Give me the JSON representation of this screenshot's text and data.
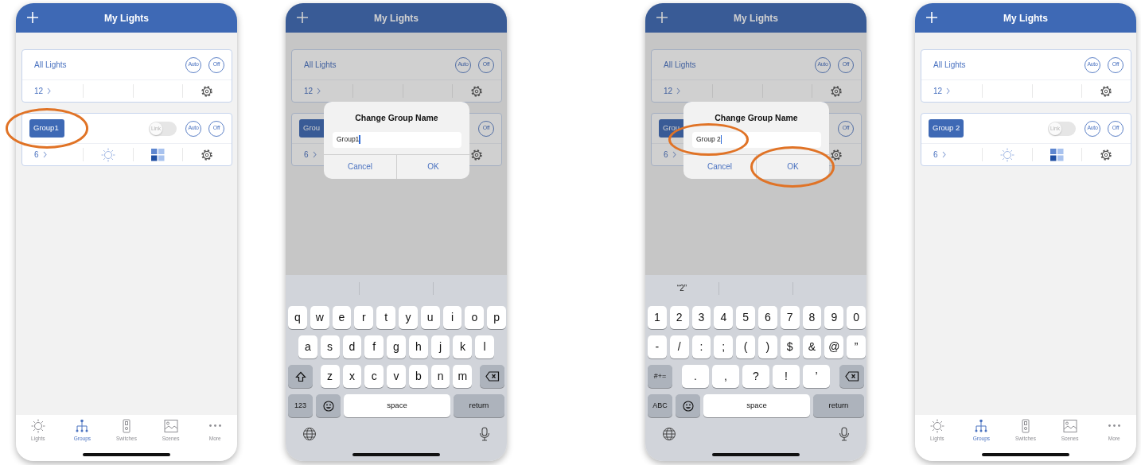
{
  "phones": [
    {
      "header": {
        "title": "My Lights"
      },
      "dimmed": false,
      "cards": [
        {
          "kind": "all",
          "name": "All Lights",
          "buttons": [
            "Auto",
            "Off"
          ],
          "count": "12"
        },
        {
          "kind": "group",
          "name": "Group1",
          "highlighted": true,
          "link": {
            "label": "Link",
            "on": false
          },
          "buttons": [
            "Auto",
            "Off"
          ],
          "count": "6",
          "mode_icons": true
        }
      ],
      "tab_bar": [
        {
          "label": "Lights",
          "selected": false
        },
        {
          "label": "Groups",
          "selected": true
        },
        {
          "label": "Switches",
          "selected": false
        },
        {
          "label": "Scenes",
          "selected": false
        },
        {
          "label": "More",
          "selected": false
        }
      ]
    },
    {
      "header": {
        "title": "My Lights"
      },
      "dimmed": true,
      "cards": [
        {
          "kind": "all",
          "name": "All Lights",
          "buttons": [
            "Auto",
            "Off"
          ],
          "count": "12"
        },
        {
          "kind": "group",
          "name": "Grou",
          "highlighted": false,
          "buttons": [
            "Off"
          ],
          "count": "6"
        }
      ],
      "dialog": {
        "title": "Change Group Name",
        "field": {
          "value": "Group1",
          "highlighted": false
        },
        "buttons": [
          {
            "label": "Cancel",
            "highlighted": false
          },
          {
            "label": "OK",
            "highlighted": false
          }
        ]
      },
      "keyboard": {
        "rows": [
          {
            "keys": [
              {
                "kind": "char",
                "label": "q"
              },
              {
                "kind": "char",
                "label": "w"
              },
              {
                "kind": "char",
                "label": "e"
              },
              {
                "kind": "char",
                "label": "r"
              },
              {
                "kind": "char",
                "label": "t"
              },
              {
                "kind": "char",
                "label": "y"
              },
              {
                "kind": "char",
                "label": "u"
              },
              {
                "kind": "char",
                "label": "i"
              },
              {
                "kind": "char",
                "label": "o"
              },
              {
                "kind": "char",
                "label": "p"
              }
            ]
          },
          {
            "keys": [
              {
                "kind": "char",
                "label": "a"
              },
              {
                "kind": "char",
                "label": "s"
              },
              {
                "kind": "char",
                "label": "d"
              },
              {
                "kind": "char",
                "label": "f"
              },
              {
                "kind": "char",
                "label": "g"
              },
              {
                "kind": "char",
                "label": "h"
              },
              {
                "kind": "char",
                "label": "j"
              },
              {
                "kind": "char",
                "label": "k"
              },
              {
                "kind": "char",
                "label": "l"
              }
            ]
          },
          {
            "keys": [
              {
                "kind": "shift"
              },
              {
                "kind": "char",
                "label": "z"
              },
              {
                "kind": "char",
                "label": "x"
              },
              {
                "kind": "char",
                "label": "c"
              },
              {
                "kind": "char",
                "label": "v"
              },
              {
                "kind": "char",
                "label": "b"
              },
              {
                "kind": "char",
                "label": "n"
              },
              {
                "kind": "char",
                "label": "m"
              },
              {
                "kind": "delete"
              }
            ]
          },
          {
            "keys": [
              {
                "kind": "mode",
                "label": "123"
              },
              {
                "kind": "emoji"
              },
              {
                "kind": "space",
                "label": "space"
              },
              {
                "kind": "return",
                "label": "return"
              }
            ]
          }
        ]
      }
    },
    {
      "header": {
        "title": "My Lights"
      },
      "dimmed": true,
      "cards": [
        {
          "kind": "all",
          "name": "All Lights",
          "buttons": [
            "Auto",
            "Off"
          ],
          "count": "12"
        },
        {
          "kind": "group",
          "name": "Grou",
          "highlighted": false,
          "buttons": [
            "Off"
          ],
          "count": "6"
        }
      ],
      "dialog": {
        "title": "Change Group Name",
        "field": {
          "value": "Group 2",
          "highlighted": true
        },
        "buttons": [
          {
            "label": "Cancel",
            "highlighted": false
          },
          {
            "label": "OK",
            "highlighted": true
          }
        ]
      },
      "keyboard": {
        "suggestions": [
          "“2”"
        ],
        "rows": [
          {
            "keys": [
              {
                "kind": "char",
                "label": "1"
              },
              {
                "kind": "char",
                "label": "2"
              },
              {
                "kind": "char",
                "label": "3"
              },
              {
                "kind": "char",
                "label": "4"
              },
              {
                "kind": "char",
                "label": "5"
              },
              {
                "kind": "char",
                "label": "6"
              },
              {
                "kind": "char",
                "label": "7"
              },
              {
                "kind": "char",
                "label": "8"
              },
              {
                "kind": "char",
                "label": "9"
              },
              {
                "kind": "char",
                "label": "0"
              }
            ]
          },
          {
            "keys": [
              {
                "kind": "char",
                "label": "-"
              },
              {
                "kind": "char",
                "label": "/"
              },
              {
                "kind": "char",
                "label": ":"
              },
              {
                "kind": "char",
                "label": ";"
              },
              {
                "kind": "char",
                "label": "("
              },
              {
                "kind": "char",
                "label": ")"
              },
              {
                "kind": "char",
                "label": "$"
              },
              {
                "kind": "char",
                "label": "&"
              },
              {
                "kind": "char",
                "label": "@"
              },
              {
                "kind": "char",
                "label": "”"
              }
            ]
          },
          {
            "keys": [
              {
                "kind": "mode",
                "label": "#+="
              },
              {
                "kind": "char",
                "label": "."
              },
              {
                "kind": "char",
                "label": ","
              },
              {
                "kind": "char",
                "label": "?"
              },
              {
                "kind": "char",
                "label": "!"
              },
              {
                "kind": "char",
                "label": "’"
              },
              {
                "kind": "delete"
              }
            ]
          },
          {
            "keys": [
              {
                "kind": "mode",
                "label": "ABC"
              },
              {
                "kind": "emoji"
              },
              {
                "kind": "space",
                "label": "space"
              },
              {
                "kind": "return",
                "label": "return"
              }
            ]
          }
        ]
      }
    },
    {
      "header": {
        "title": "My Lights"
      },
      "dimmed": false,
      "cards": [
        {
          "kind": "all",
          "name": "All Lights",
          "buttons": [
            "Auto",
            "Off"
          ],
          "count": "12"
        },
        {
          "kind": "group",
          "name": "Group 2",
          "highlighted": false,
          "link": {
            "label": "Link",
            "on": false
          },
          "buttons": [
            "Auto",
            "Off"
          ],
          "count": "6",
          "mode_icons": true
        }
      ],
      "tab_bar": [
        {
          "label": "Lights",
          "selected": false
        },
        {
          "label": "Groups",
          "selected": true
        },
        {
          "label": "Switches",
          "selected": false
        },
        {
          "label": "Scenes",
          "selected": false
        },
        {
          "label": "More",
          "selected": false
        }
      ]
    }
  ]
}
